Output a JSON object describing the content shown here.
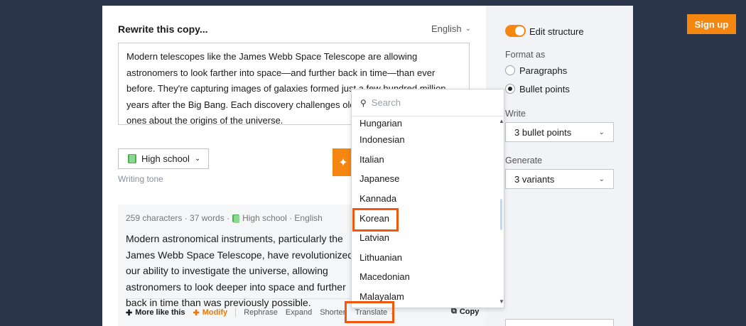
{
  "header": {
    "signup_label": "Sign up"
  },
  "editor": {
    "title": "Rewrite this copy...",
    "language": "English",
    "input_text": "Modern telescopes like the James Webb Space Telescope are allowing astronomers to look farther into space—and further back in time—than ever before. They're capturing images of galaxies formed just a few hundred million years after the Big Bang. Each discovery challenges old theories and sparks new ones about the origins of the universe.",
    "tone_value": "High school",
    "tone_label": "Writing tone"
  },
  "result": {
    "meta_stats": "259 characters · 37 words ·",
    "meta_tone": "High school · English",
    "text": "Modern astronomical instruments, particularly the James Webb Space Telescope, have revolutionized our ability to investigate the universe, allowing astronomers to look deeper into space and further back in time than was previously possible.",
    "actions": {
      "more_like_this": "More like this",
      "modify": "Modify",
      "rephrase": "Rephrase",
      "expand": "Expand",
      "shorten": "Shorten",
      "translate": "Translate",
      "copy": "Copy"
    }
  },
  "language_dropdown": {
    "search_placeholder": "Search",
    "items": [
      "Hungarian",
      "Indonesian",
      "Italian",
      "Japanese",
      "Kannada",
      "Korean",
      "Latvian",
      "Lithuanian",
      "Macedonian",
      "Malayalam"
    ],
    "highlighted": "Korean"
  },
  "settings": {
    "edit_structure_label": "Edit structure",
    "edit_structure_on": true,
    "format_label": "Format as",
    "format_options": [
      "Paragraphs",
      "Bullet points"
    ],
    "format_selected": "Bullet points",
    "write_label": "Write",
    "write_value": "3 bullet points",
    "generate_label": "Generate",
    "generate_value": "3 variants"
  },
  "colors": {
    "accent": "#f5860f",
    "highlight": "#f0570f",
    "background": "#2b3549"
  }
}
